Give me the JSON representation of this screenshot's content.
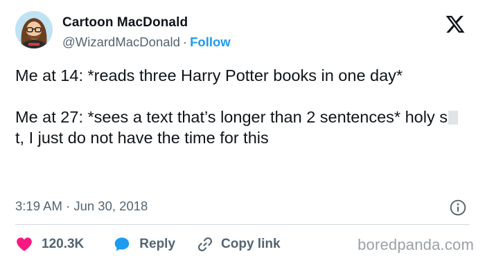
{
  "author": {
    "name": "Cartoon MacDonald",
    "handle": "@WizardMacDonald",
    "separator": "·",
    "follow_label": "Follow",
    "avatar_icon": "cartoon-avatar"
  },
  "platform_icon": "x-logo-icon",
  "tweet": {
    "line1": "Me at 14: *reads three Harry Potter books in one day*",
    "line2_before": "Me at 27: *sees a text that’s longer than 2 sentences* holy s",
    "line2_after": "t, I just do not have the time for this"
  },
  "meta": {
    "time": "3:19 AM",
    "separator": "·",
    "date": "Jun 30, 2018",
    "info_icon": "info-icon"
  },
  "actions": {
    "likes": "120.3K",
    "reply_label": "Reply",
    "copy_label": "Copy link"
  },
  "colors": {
    "accent": "#1d9bf0",
    "like": "#f91880",
    "text": "#0f1419",
    "muted": "#536471",
    "divider": "#cfd9de"
  },
  "watermark": "boredpanda.com"
}
